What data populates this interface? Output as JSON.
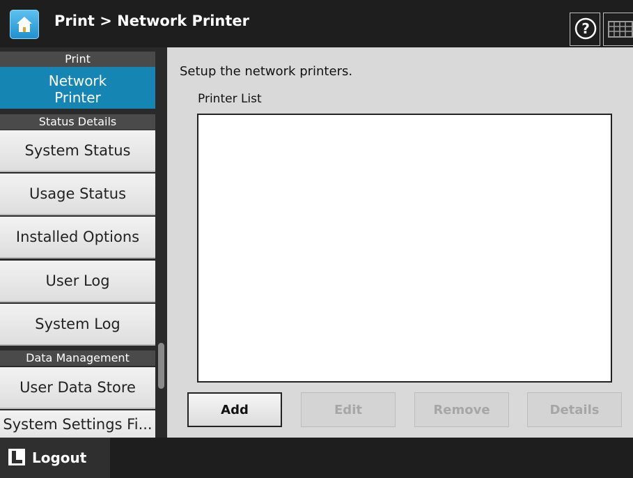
{
  "header": {
    "title": "Print > Network Printer",
    "home_icon": "home-icon",
    "help_icon": "help-icon",
    "keyboard_icon": "keyboard-icon"
  },
  "sidebar": {
    "print_header": "Print",
    "active_item": "Network\nPrinter",
    "status_header": "Status Details",
    "status_items": [
      "System Status",
      "Usage Status",
      "Installed Options",
      "User Log",
      "System Log"
    ],
    "data_header": "Data Management",
    "data_items": [
      "User Data Store",
      "System Settings Fi..."
    ]
  },
  "main": {
    "description": "Setup the network printers.",
    "list_label": "Printer List",
    "buttons": {
      "add": "Add",
      "edit": "Edit",
      "remove": "Remove",
      "details": "Details"
    }
  },
  "footer": {
    "logout_label": "Logout",
    "logout_icon": "logout-icon"
  },
  "colors": {
    "accent": "#1586b3",
    "topbar": "#1e1e1e",
    "main_bg": "#d9d9d9"
  }
}
